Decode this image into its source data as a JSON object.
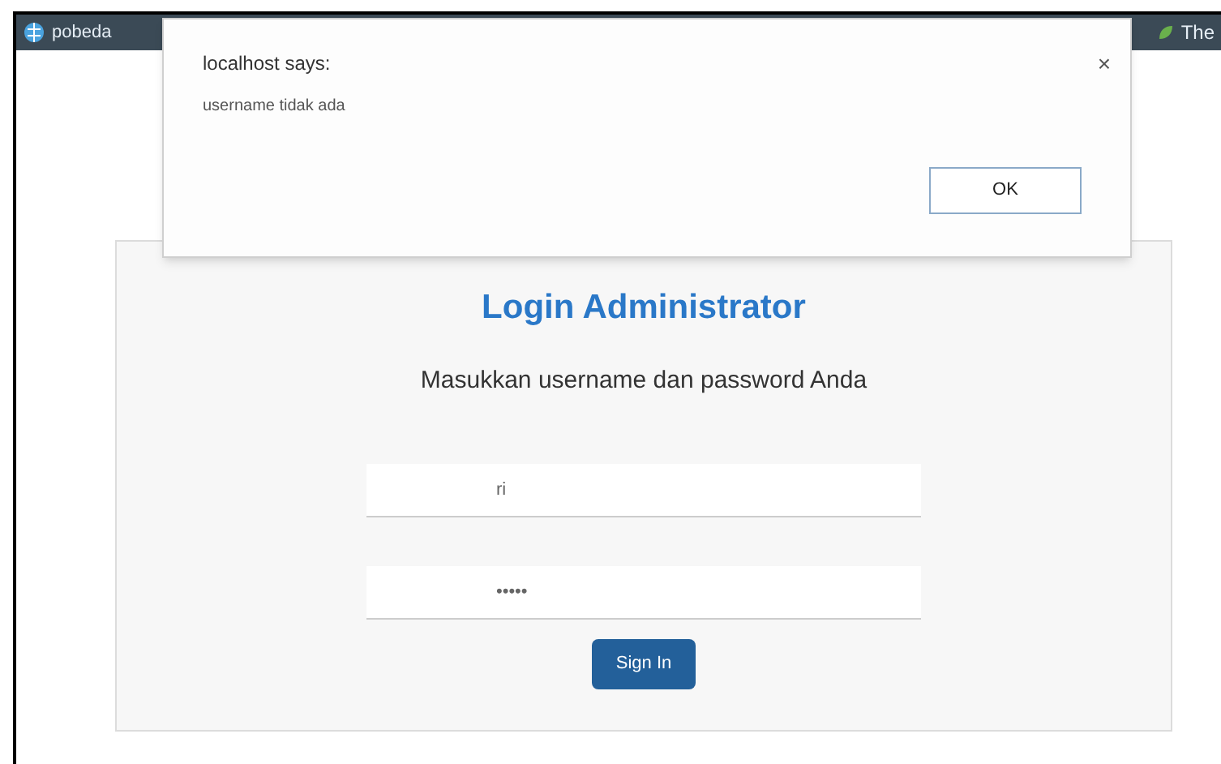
{
  "bookmarks": [
    {
      "label": "pobeda"
    },
    {
      "label": "The"
    }
  ],
  "dialog": {
    "title": "localhost says:",
    "message": "username tidak ada",
    "close": "×",
    "button": "OK"
  },
  "login": {
    "title": "Login Administrator",
    "subtitle": "Masukkan username dan password Anda",
    "username": "ri",
    "password": "•••••",
    "button": "Sign In"
  }
}
